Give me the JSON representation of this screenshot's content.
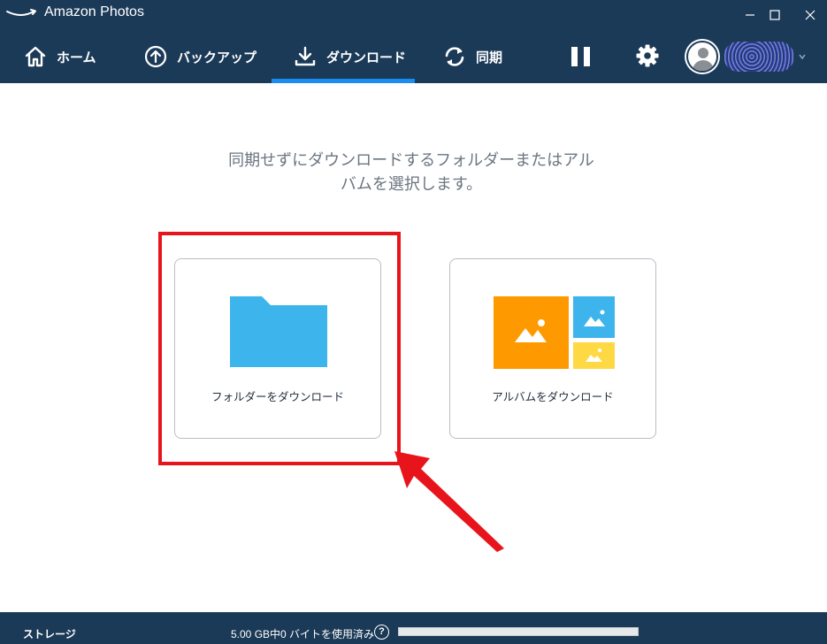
{
  "window": {
    "title": "Amazon Photos",
    "icons": [
      "amazon-smile-logo",
      "minimize-icon",
      "maximize-icon",
      "close-icon"
    ]
  },
  "nav": {
    "items": [
      {
        "label": "ホーム",
        "icon": "home-icon",
        "active": false
      },
      {
        "label": "バックアップ",
        "icon": "upload-circle-icon",
        "active": false
      },
      {
        "label": "ダウンロード",
        "icon": "download-icon",
        "active": true
      },
      {
        "label": "同期",
        "icon": "sync-icon",
        "active": false
      }
    ],
    "right_icons": [
      "pause-icon",
      "gear-icon",
      "avatar-icon",
      "chevron-down-icon"
    ]
  },
  "main": {
    "instruction": "同期せずにダウンロードするフォルダーまたはアルバムを選択します。",
    "cards": [
      {
        "label": "フォルダーをダウンロード",
        "icon": "folder-icon"
      },
      {
        "label": "アルバムをダウンロード",
        "icon": "album-icon"
      }
    ]
  },
  "annotation": {
    "highlight_color": "#e8141c"
  },
  "status": {
    "storage_label": "ストレージ",
    "usage_text": "5.00 GB中0 バイトを使用済み",
    "help_glyph": "?",
    "used_fraction": 0
  },
  "colors": {
    "header_bg": "#1b3a57",
    "accent_blue": "#1b8cf2",
    "folder_blue": "#3db5ec",
    "album_orange": "#ff9900",
    "album_blue": "#3db5ec",
    "album_yellow": "#ffd943"
  }
}
